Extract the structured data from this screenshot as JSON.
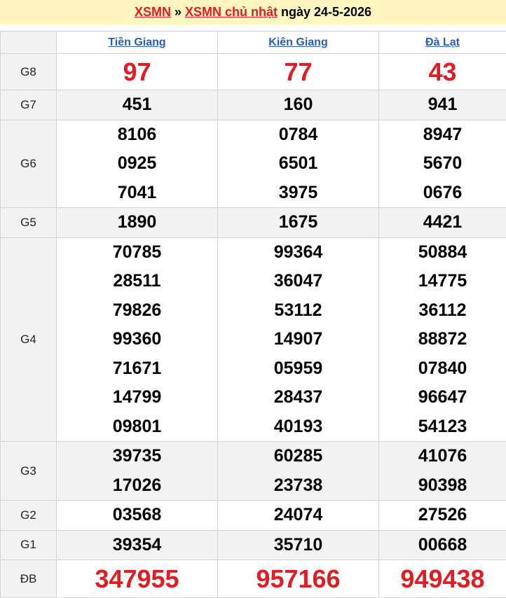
{
  "header": {
    "link1": "XSMN",
    "sep": "»",
    "link2": "XSMN chủ nhật",
    "date_text": "ngày 24-5-2026"
  },
  "provinces": [
    "Tiền Giang",
    "Kiên Giang",
    "Đà Lạt"
  ],
  "prizes": [
    {
      "label": "G8",
      "values": [
        [
          "97"
        ],
        [
          "77"
        ],
        [
          "43"
        ]
      ]
    },
    {
      "label": "G7",
      "values": [
        [
          "451"
        ],
        [
          "160"
        ],
        [
          "941"
        ]
      ]
    },
    {
      "label": "G6",
      "values": [
        [
          "8106",
          "0925",
          "7041"
        ],
        [
          "0784",
          "6501",
          "3975"
        ],
        [
          "8947",
          "5670",
          "0676"
        ]
      ]
    },
    {
      "label": "G5",
      "values": [
        [
          "1890"
        ],
        [
          "1675"
        ],
        [
          "4421"
        ]
      ]
    },
    {
      "label": "G4",
      "values": [
        [
          "70785",
          "28511",
          "79826",
          "99360",
          "71671",
          "14799",
          "09801"
        ],
        [
          "99364",
          "36047",
          "53112",
          "14907",
          "05959",
          "28437",
          "40193"
        ],
        [
          "50884",
          "14775",
          "36112",
          "88872",
          "07840",
          "96647",
          "54123"
        ]
      ]
    },
    {
      "label": "G3",
      "values": [
        [
          "39735",
          "17026"
        ],
        [
          "60285",
          "23738"
        ],
        [
          "41076",
          "90398"
        ]
      ]
    },
    {
      "label": "G2",
      "values": [
        [
          "03568"
        ],
        [
          "24074"
        ],
        [
          "27526"
        ]
      ]
    },
    {
      "label": "G1",
      "values": [
        [
          "39354"
        ],
        [
          "35710"
        ],
        [
          "00668"
        ]
      ]
    },
    {
      "label": "ĐB",
      "values": [
        [
          "347955"
        ],
        [
          "957166"
        ],
        [
          "949438"
        ]
      ]
    }
  ],
  "colors": {
    "accent_red": "#e31b23",
    "link_blue": "#2a5db0",
    "header_bg": "#fff6c2",
    "row_shade": "#f2f2f2"
  }
}
